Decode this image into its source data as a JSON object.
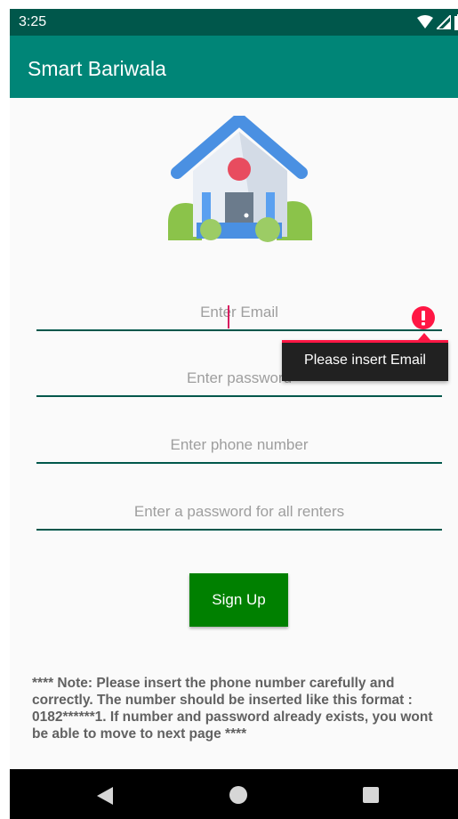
{
  "status_bar": {
    "time": "3:25"
  },
  "app_bar": {
    "title": "Smart Bariwala"
  },
  "logo": {
    "icon": "house-icon"
  },
  "form": {
    "email": {
      "placeholder": "Enter Email",
      "value": ""
    },
    "password": {
      "placeholder": "Enter password",
      "value": ""
    },
    "phone": {
      "placeholder": "Enter phone number",
      "value": ""
    },
    "renter_password": {
      "placeholder": "Enter a password for all renters",
      "value": ""
    }
  },
  "error": {
    "message": "Please insert Email",
    "icon": "error-icon",
    "color": "#ff1744"
  },
  "signup_button": {
    "label": "Sign Up",
    "color": "#008000"
  },
  "note": {
    "text": "**** Note: Please insert the phone number carefully and correctly. The number should be inserted like this format : 0182******1. If number and password already exists, you wont be able to move to next page ****"
  },
  "colors": {
    "primary": "#008577",
    "primary_dark": "#00574b",
    "accent": "#d81b60"
  }
}
